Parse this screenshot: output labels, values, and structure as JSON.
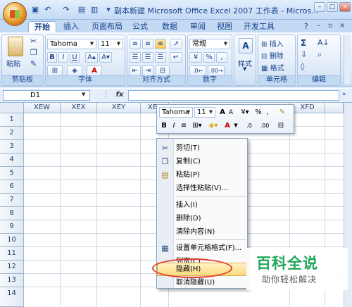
{
  "window": {
    "title": "副本新建 Microsoft Office Excel 2007 工作表 - Micros..."
  },
  "ribbon": {
    "tabs": [
      "开始",
      "插入",
      "页面布局",
      "公式",
      "数据",
      "审阅",
      "视图",
      "开发工具"
    ],
    "active_tab": "开始",
    "clipboard": {
      "paste_label": "粘贴",
      "group_label": "剪贴板"
    },
    "font": {
      "family": "Tahoma",
      "size": "11",
      "bold": "B",
      "italic": "I",
      "underline": "U",
      "font_color": "A",
      "group_label": "字体"
    },
    "alignment": {
      "group_label": "对齐方式"
    },
    "number": {
      "format": "常规",
      "percent": "%",
      "comma": ",",
      "group_label": "数字"
    },
    "styles": {
      "label": "样式"
    },
    "cells": {
      "insert": "插入",
      "delete": "删除",
      "format": "格式",
      "group_label": "单元格"
    },
    "editing": {
      "sigma": "Σ",
      "group_label": "编辑"
    }
  },
  "formula_bar": {
    "name_box": "D1",
    "fx": "fx",
    "value": ""
  },
  "grid": {
    "columns": [
      "XEW",
      "XEX",
      "XEY",
      "XE",
      "XFD"
    ],
    "rows": [
      "1",
      "2",
      "3",
      "4",
      "5",
      "6",
      "7",
      "8",
      "9",
      "10",
      "11",
      "12",
      "13",
      "14"
    ]
  },
  "mini_toolbar": {
    "font_family": "Tahoma",
    "font_size": "11",
    "grow_font": "A",
    "shrink_font": "A",
    "percent": "%",
    "comma": ",",
    "bold": "B",
    "italic": "I",
    "font_color": "A",
    "inc_decimal": ".0",
    "dec_decimal": ".00"
  },
  "context_menu": {
    "items": [
      {
        "label": "剪切(T)",
        "icon": "scissors-icon"
      },
      {
        "label": "复制(C)",
        "icon": "copy-icon"
      },
      {
        "label": "粘贴(P)",
        "icon": "paste-icon"
      },
      {
        "label": "选择性粘贴(V)...",
        "icon": ""
      },
      {
        "label": "插入(I)",
        "icon": ""
      },
      {
        "label": "删除(D)",
        "icon": ""
      },
      {
        "label": "清除内容(N)",
        "icon": ""
      },
      {
        "label": "设置单元格格式(F)...",
        "icon": "format-cells-icon"
      },
      {
        "label": "列宽(C)...",
        "icon": ""
      },
      {
        "label": "隐藏(H)",
        "icon": "",
        "highlighted": true
      },
      {
        "label": "取消隐藏(U)",
        "icon": ""
      }
    ]
  },
  "watermark": {
    "title": "百科全说",
    "subtitle": "助你轻松解决"
  }
}
